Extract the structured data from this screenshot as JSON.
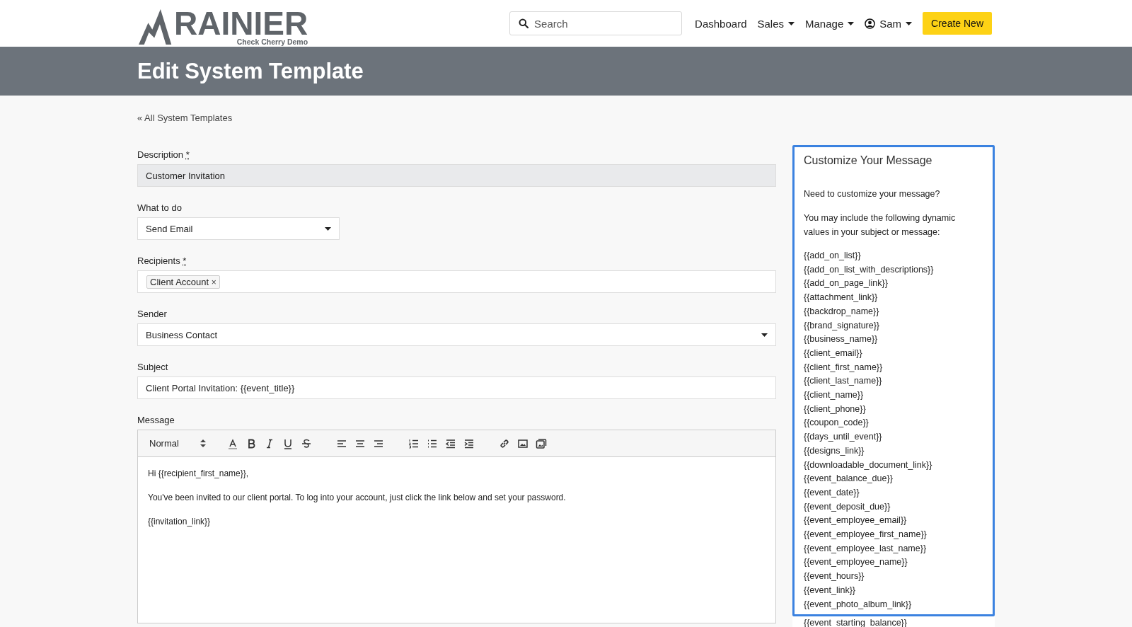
{
  "brand": {
    "name": "RAINIER",
    "subtitle": "Check Cherry Demo"
  },
  "search": {
    "placeholder": "Search"
  },
  "nav": [
    {
      "label": "Dashboard",
      "dropdown": false
    },
    {
      "label": "Sales",
      "dropdown": true
    },
    {
      "label": "Manage",
      "dropdown": true
    },
    {
      "label": "Sam",
      "dropdown": true,
      "user": true
    }
  ],
  "create_button": "Create New",
  "page_title": "Edit System Template",
  "back_link": "« All System Templates",
  "form": {
    "description": {
      "label": "Description",
      "required_mark": "*",
      "value": "Customer Invitation",
      "disabled": true
    },
    "what_to_do": {
      "label": "What to do",
      "value": "Send Email"
    },
    "recipients": {
      "label": "Recipients",
      "required_mark": "*",
      "tags": [
        {
          "label": "Client Account",
          "remove": "×"
        }
      ]
    },
    "sender": {
      "label": "Sender",
      "value": "Business Contact"
    },
    "subject": {
      "label": "Subject",
      "value": "Client Portal Invitation: {{event_title}}"
    },
    "message": {
      "label": "Message",
      "format": "Normal",
      "paragraphs": [
        "Hi {{recipient_first_name}},",
        "You've been invited to our client portal. To log into your account, just click the link below and set your password.",
        "{{invitation_link}}"
      ]
    }
  },
  "help_panel": {
    "title": "Customize Your Message",
    "intro": "Need to customize your message?",
    "instructions": "You may include the following dynamic values in your subject or message:",
    "values": [
      "{{add_on_list}}",
      "{{add_on_list_with_descriptions}}",
      "{{add_on_page_link}}",
      "{{attachment_link}}",
      "{{backdrop_name}}",
      "{{brand_signature}}",
      "{{business_name}}",
      "{{client_email}}",
      "{{client_first_name}}",
      "{{client_last_name}}",
      "{{client_name}}",
      "{{client_phone}}",
      "{{coupon_code}}",
      "{{days_until_event}}",
      "{{designs_link}}",
      "{{downloadable_document_link}}",
      "{{event_balance_due}}",
      "{{event_date}}",
      "{{event_deposit_due}}",
      "{{event_employee_email}}",
      "{{event_employee_first_name}}",
      "{{event_employee_last_name}}",
      "{{event_employee_name}}",
      "{{event_hours}}",
      "{{event_link}}",
      "{{event_photo_album_link}}"
    ],
    "values_below": [
      "{{event_starting_balance}}"
    ]
  }
}
